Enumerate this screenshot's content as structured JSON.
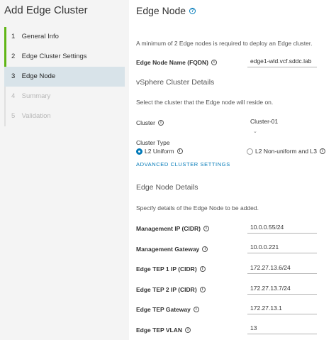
{
  "sidebar": {
    "title": "Add Edge Cluster",
    "steps": [
      {
        "num": "1",
        "label": "General Info"
      },
      {
        "num": "2",
        "label": "Edge Cluster Settings"
      },
      {
        "num": "3",
        "label": "Edge Node"
      },
      {
        "num": "4",
        "label": "Summary"
      },
      {
        "num": "5",
        "label": "Validation"
      }
    ]
  },
  "main": {
    "title": "Edge Node",
    "min_nodes_note": "A minimum of 2 Edge nodes is required to deploy an Edge cluster.",
    "edge_node_name": {
      "label": "Edge Node Name (FQDN)",
      "value": "edge1-wld.vcf.sddc.lab"
    },
    "vsphere_section": "vSphere Cluster Details",
    "vsphere_desc": "Select the cluster that the Edge node will reside on.",
    "cluster": {
      "label": "Cluster",
      "value": "Cluster-01"
    },
    "cluster_type": {
      "label": "Cluster Type",
      "option_l2": "L2 Uniform",
      "option_l3": "L2 Non-uniform and L3"
    },
    "advanced_link": "ADVANCED CLUSTER SETTINGS",
    "edge_details_section": "Edge Node Details",
    "edge_details_desc": "Specify details of the Edge Node to be added.",
    "mgmt_ip": {
      "label": "Management IP (CIDR)",
      "value": "10.0.0.55/24"
    },
    "mgmt_gw": {
      "label": "Management Gateway",
      "value": "10.0.0.221"
    },
    "tep1": {
      "label": "Edge TEP 1 IP (CIDR)",
      "value": "172.27.13.6/24"
    },
    "tep2": {
      "label": "Edge TEP 2 IP (CIDR)",
      "value": "172.27.13.7/24"
    },
    "tep_gw": {
      "label": "Edge TEP Gateway",
      "value": "172.27.13.1"
    },
    "tep_vlan": {
      "label": "Edge TEP VLAN",
      "value": "13"
    }
  },
  "colors": {
    "accent": "#0079b8",
    "done": "#60b515",
    "active_bg": "#d8e3e9"
  }
}
